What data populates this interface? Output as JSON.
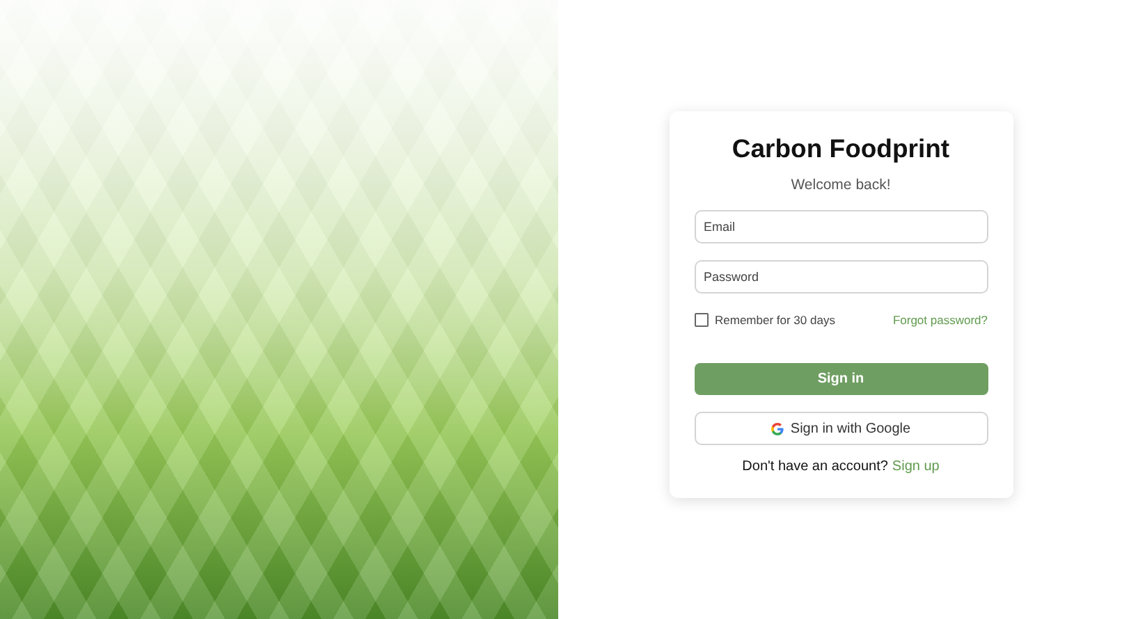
{
  "app": {
    "title": "Carbon Foodprint",
    "subtitle": "Welcome back!"
  },
  "fields": [
    {
      "placeholder": "Email"
    },
    {
      "placeholder": "Password"
    }
  ],
  "remember": {
    "label": "Remember for 30 days",
    "checked": false
  },
  "forgot_link": "Forgot password?",
  "sign_in_button": "Sign in",
  "google_button": "Sign in with Google",
  "signup": {
    "prompt": "Don't have an account?",
    "link": "Sign up"
  }
}
